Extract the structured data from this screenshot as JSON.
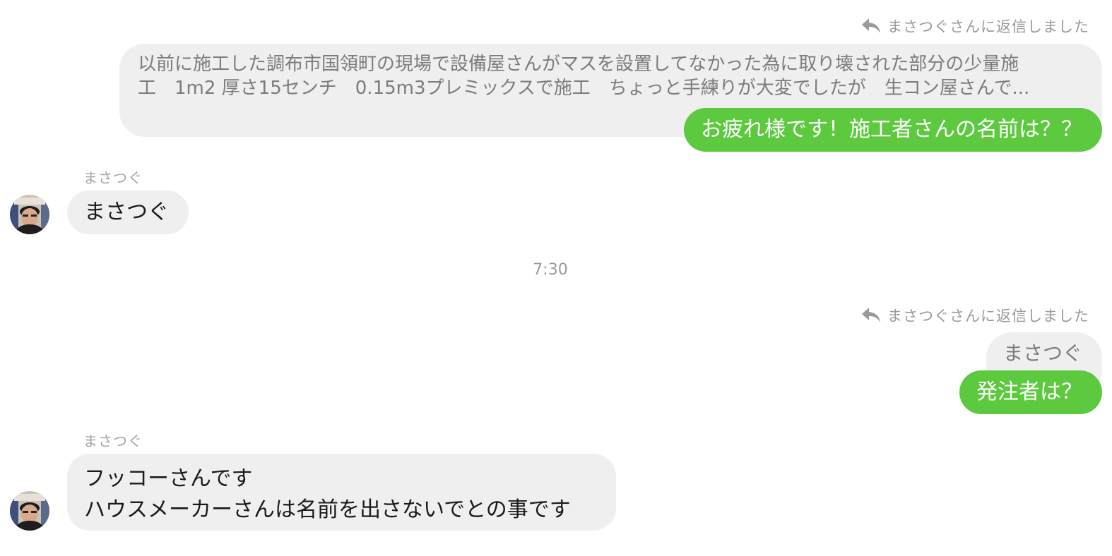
{
  "colors": {
    "outgoing_bubble": "#5cc93f",
    "incoming_bubble": "#efefef",
    "meta_text": "#9a9a9a"
  },
  "messages": [
    {
      "direction": "outgoing",
      "reply_tag": "まさつぐさんに返信しました",
      "reply_icon": "reply-arrow-icon",
      "quoted_lines": [
        "以前に施工した調布市国領町の現場で設備屋さんがマスを設置してなかった為に取り壊された部分の少量施",
        "工　1m2 厚さ15センチ　0.15m3プレミックスで施工　ちょっと手練りが大変でしたが　生コン屋さんで..."
      ],
      "text": "お疲れ様です！施工者さんの名前は？？"
    },
    {
      "direction": "incoming",
      "sender": "まさつぐ",
      "avatar": "sender-avatar",
      "text": "まさつぐ"
    },
    {
      "type": "timestamp",
      "text": "7:30"
    },
    {
      "direction": "outgoing",
      "reply_tag": "まさつぐさんに返信しました",
      "reply_icon": "reply-arrow-icon",
      "quoted_lines": [
        "まさつぐ"
      ],
      "text": "発注者は？"
    },
    {
      "direction": "incoming",
      "sender": "まさつぐ",
      "avatar": "sender-avatar",
      "lines": [
        "フッコーさんです",
        "ハウスメーカーさんは名前を出さないでとの事です"
      ]
    }
  ]
}
